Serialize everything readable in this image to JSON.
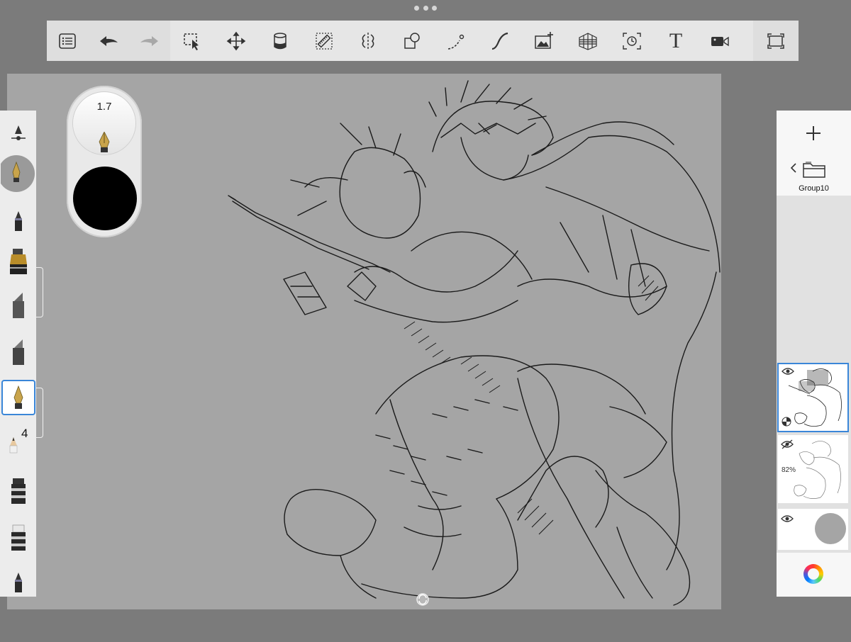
{
  "toolbar": {
    "items": [
      {
        "name": "layer-list",
        "icon": "list-icon"
      },
      {
        "name": "undo",
        "icon": "undo-icon"
      },
      {
        "name": "redo",
        "icon": "redo-icon"
      },
      {
        "name": "selection",
        "icon": "selection-icon"
      },
      {
        "name": "transform",
        "icon": "move-icon"
      },
      {
        "name": "fill",
        "icon": "bucket-icon"
      },
      {
        "name": "ruler",
        "icon": "ruler-icon"
      },
      {
        "name": "symmetry",
        "icon": "symmetry-icon"
      },
      {
        "name": "shapes",
        "icon": "shapes-icon"
      },
      {
        "name": "stroke",
        "icon": "stroke-icon"
      },
      {
        "name": "curve",
        "icon": "curve-icon"
      },
      {
        "name": "add-image",
        "icon": "image-add-icon"
      },
      {
        "name": "perspective",
        "icon": "perspective-grid-icon"
      },
      {
        "name": "time-lapse",
        "icon": "timelapse-icon"
      },
      {
        "name": "text",
        "icon": "text-icon",
        "label": "T"
      },
      {
        "name": "video",
        "icon": "video-icon"
      },
      {
        "name": "fullscreen",
        "icon": "fullscreen-icon"
      }
    ]
  },
  "brush": {
    "size": "1.7",
    "color": "#000000"
  },
  "left_tools": {
    "badge_number": "4"
  },
  "layers": {
    "group_name": "Group10",
    "items": [
      {
        "visible": true,
        "selected": true
      },
      {
        "visible": false,
        "opacity": "82%"
      },
      {
        "visible": true,
        "swatch": "#a5a5a5"
      }
    ]
  },
  "colors": {
    "accent": "#3a86d8",
    "canvas": "#a5a5a5"
  }
}
